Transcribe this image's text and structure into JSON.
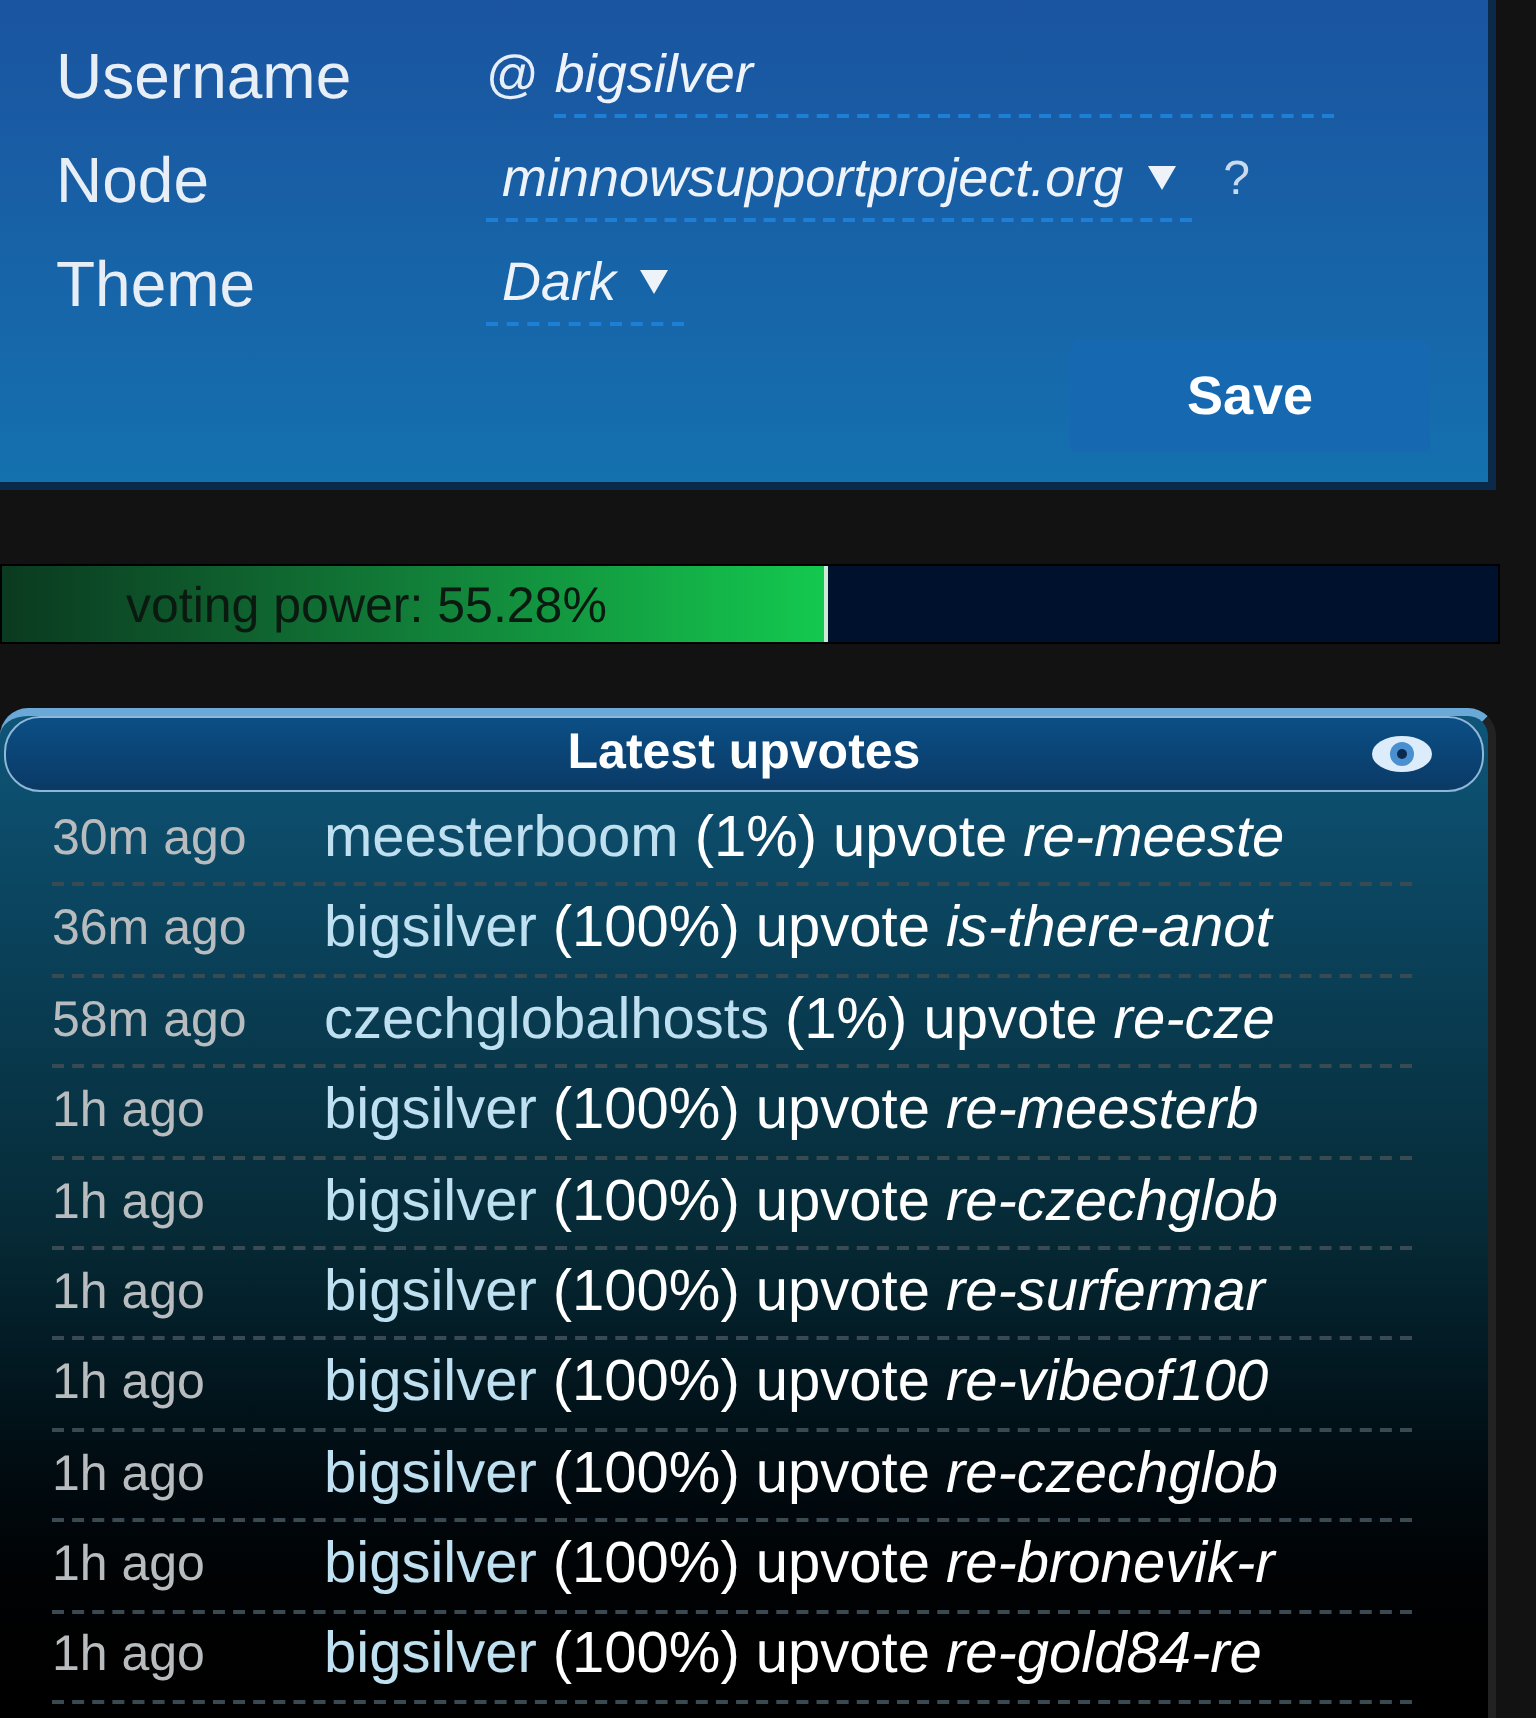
{
  "settings": {
    "fields": [
      {
        "label": "Username",
        "prefix": "@",
        "value": "bigsilver",
        "kind": "text"
      },
      {
        "label": "Node",
        "value": "minnowsupportproject.org",
        "kind": "select",
        "help": "?"
      },
      {
        "label": "Theme",
        "value": "Dark",
        "kind": "select"
      }
    ],
    "save_button": "Save"
  },
  "voting_power": {
    "label": "voting power: 55.28%",
    "level": 0.5528
  },
  "upvotes": {
    "title": "Latest upvotes",
    "rows": [
      {
        "time": "30m ago",
        "voter": "meesterboom",
        "percent": "(1%)",
        "action": "upvote",
        "post": "re-meeste"
      },
      {
        "time": "36m ago",
        "voter": "bigsilver",
        "percent": "(100%)",
        "action": "upvote",
        "post": "is-there-anot"
      },
      {
        "time": "58m ago",
        "voter": "czechglobalhosts",
        "percent": "(1%)",
        "action": "upvote",
        "post": "re-cze"
      },
      {
        "time": "1h ago",
        "voter": "bigsilver",
        "percent": "(100%)",
        "action": "upvote",
        "post": "re-meesterb"
      },
      {
        "time": "1h ago",
        "voter": "bigsilver",
        "percent": "(100%)",
        "action": "upvote",
        "post": "re-czechglob"
      },
      {
        "time": "1h ago",
        "voter": "bigsilver",
        "percent": "(100%)",
        "action": "upvote",
        "post": "re-surfermar"
      },
      {
        "time": "1h ago",
        "voter": "bigsilver",
        "percent": "(100%)",
        "action": "upvote",
        "post": "re-vibeof100"
      },
      {
        "time": "1h ago",
        "voter": "bigsilver",
        "percent": "(100%)",
        "action": "upvote",
        "post": "re-czechglob"
      },
      {
        "time": "1h ago",
        "voter": "bigsilver",
        "percent": "(100%)",
        "action": "upvote",
        "post": "re-bronevik-r"
      },
      {
        "time": "1h ago",
        "voter": "bigsilver",
        "percent": "(100%)",
        "action": "upvote",
        "post": "re-gold84-re"
      }
    ]
  }
}
